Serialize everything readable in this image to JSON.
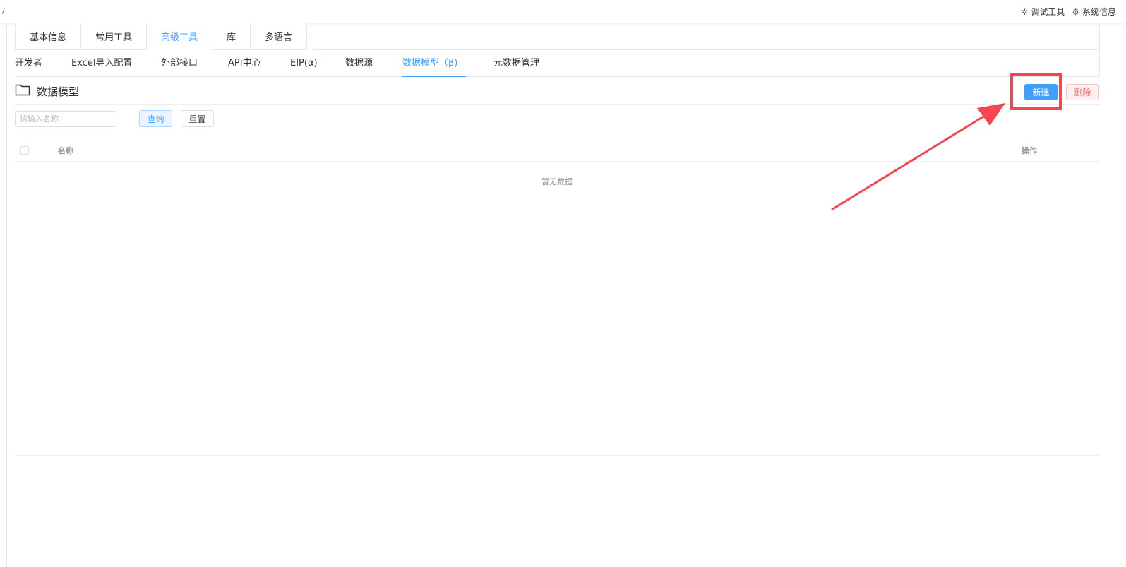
{
  "breadcrumb": "/",
  "toolbar": {
    "debug_label": "调试工具",
    "sysinfo_label": "系统信息",
    "debug_icon": "bug-icon",
    "sysinfo_icon": "gear-icon"
  },
  "tabs_primary": [
    {
      "label": "基本信息"
    },
    {
      "label": "常用工具"
    },
    {
      "label": "高级工具",
      "active": true
    },
    {
      "label": "库"
    },
    {
      "label": "多语言"
    }
  ],
  "tabs_secondary": [
    {
      "label": "开发者"
    },
    {
      "label": "Excel导入配置"
    },
    {
      "label": "外部接口"
    },
    {
      "label": "API中心"
    },
    {
      "label": "EIP(α)"
    },
    {
      "label": "数据源"
    },
    {
      "label": "数据模型（β)",
      "active": true
    },
    {
      "label": "元数据管理"
    }
  ],
  "page": {
    "title": "数据模型",
    "title_icon": "folder-icon",
    "new_label": "新建",
    "delete_label": "删除"
  },
  "search": {
    "placeholder": "请输入名称",
    "value": "",
    "query_label": "查询",
    "reset_label": "重置"
  },
  "table": {
    "columns": [
      "名称",
      "操作"
    ],
    "rows": [],
    "empty_text": "暂无数据"
  },
  "colors": {
    "accent": "#409eff",
    "danger": "#f56c6c",
    "annotation": "#f5454f"
  }
}
